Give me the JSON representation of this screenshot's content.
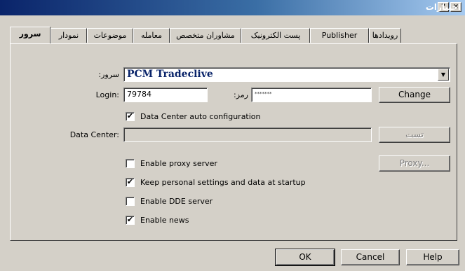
{
  "window": {
    "title": "اختیارات",
    "help_glyph": "?",
    "close_glyph": "×"
  },
  "tabs": [
    {
      "label": "سرور",
      "active": true
    },
    {
      "label": "نمودار",
      "active": false
    },
    {
      "label": "موضوعات",
      "active": false
    },
    {
      "label": "معامله",
      "active": false
    },
    {
      "label": "مشاوران متخصص",
      "active": false
    },
    {
      "label": "پست الکترونیک",
      "active": false
    },
    {
      "label": "Publisher",
      "active": false
    },
    {
      "label": "رویدادها",
      "active": false
    }
  ],
  "form": {
    "server_label": ":سرور",
    "server_value": "PCM Tradeclive",
    "login_label": "Login:",
    "login_value": "79784",
    "password_label": ":رمز",
    "password_value": "*******",
    "change_button": "Change",
    "dc_auto_label": "Data Center auto configuration",
    "dc_auto_checked": true,
    "datacenter_label": "Data Center:",
    "datacenter_value": "",
    "test_button": "تست",
    "proxy_label": "Enable proxy server",
    "proxy_checked": false,
    "proxy_button": "Proxy...",
    "keep_label": "Keep personal settings and data at startup",
    "keep_checked": true,
    "dde_label": "Enable DDE server",
    "dde_checked": false,
    "news_label": "Enable news",
    "news_checked": true
  },
  "footer": {
    "ok": "OK",
    "cancel": "Cancel",
    "help": "Help"
  },
  "icons": {
    "checked": "✔",
    "dropdown": "▼"
  }
}
